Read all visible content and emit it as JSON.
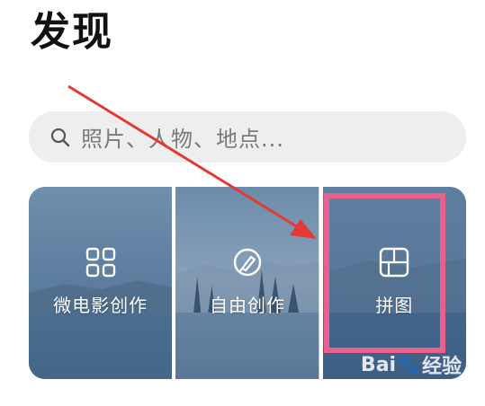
{
  "header": {
    "title": "发现"
  },
  "search": {
    "placeholder": "照片、人物、地点...",
    "icon": "search-icon"
  },
  "tiles": [
    {
      "label": "微电影创作",
      "icon": "grid-icon"
    },
    {
      "label": "自由创作",
      "icon": "brush-icon"
    },
    {
      "label": "拼图",
      "icon": "collage-icon"
    }
  ],
  "annotation": {
    "highlight_color": "#ea5f8b",
    "arrow_color": "#e53935"
  },
  "watermark": {
    "brand": "Bai",
    "brand_suffix": "经验",
    "url": "jingyan.baidu.com"
  },
  "colors": {
    "search_bg": "#eeeeee",
    "tile_sky": "#5f7fa0",
    "tile_water": "#4a6c8d"
  }
}
